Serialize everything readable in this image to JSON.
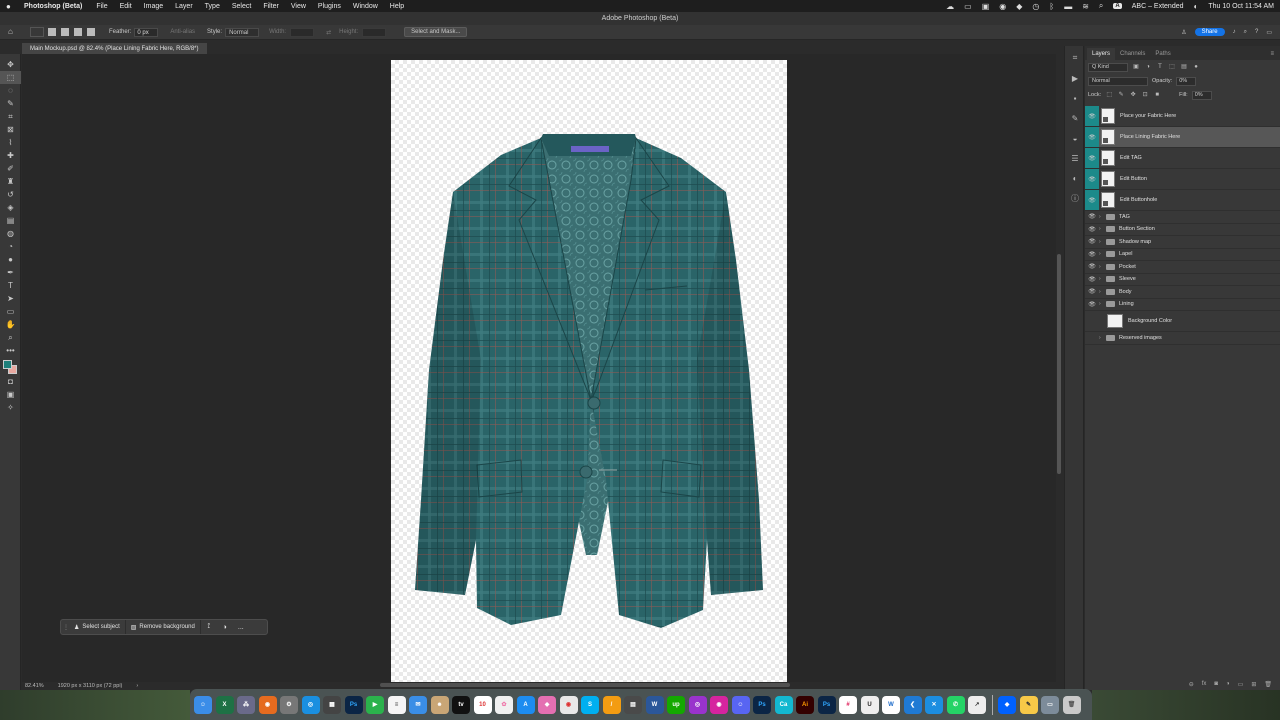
{
  "menubar": {
    "app_name": "Photoshop (Beta)",
    "items": [
      "File",
      "Edit",
      "Image",
      "Layer",
      "Type",
      "Select",
      "Filter",
      "View",
      "Plugins",
      "Window",
      "Help"
    ],
    "input_source": "ABC – Extended",
    "datetime": "Thu 10 Oct  11:54 AM"
  },
  "window": {
    "title": "Adobe Photoshop (Beta)"
  },
  "options": {
    "feather_label": "Feather:",
    "feather_value": "0 px",
    "anti_alias": "Anti-alias",
    "style_label": "Style:",
    "style_value": "Normal",
    "width_label": "Width:",
    "height_label": "Height:",
    "select_mask": "Select and Mask...",
    "share": "Share"
  },
  "document": {
    "tab_title": "Main Mockup.psd @ 82.4% (Place Lining Fabric Here, RGB/8*)",
    "zoom": "82.41%",
    "size_info": "1920 px x 3110 px (72 ppi)"
  },
  "taskbar": {
    "select_subject": "Select subject",
    "remove_background": "Remove background",
    "more": "..."
  },
  "layers_panel": {
    "tabs": [
      "Layers",
      "Channels",
      "Paths"
    ],
    "kind": "Q Kind",
    "blend_mode": "Normal",
    "opacity_label": "Opacity:",
    "opacity_value": "0%",
    "lock_label": "Lock:",
    "fill_label": "Fill:",
    "fill_value": "0%",
    "layers": [
      {
        "name": "Place your Fabric Here",
        "type": "smart",
        "selected": false
      },
      {
        "name": "Place Lining Fabric Here",
        "type": "smart",
        "selected": true
      },
      {
        "name": "Edit TAG",
        "type": "smart",
        "selected": false
      },
      {
        "name": "Edit Button",
        "type": "smart",
        "selected": false
      },
      {
        "name": "Edit Buttonhole",
        "type": "smart",
        "selected": false
      },
      {
        "name": "TAG",
        "type": "group"
      },
      {
        "name": "Button Section",
        "type": "group"
      },
      {
        "name": "Shadow map",
        "type": "group"
      },
      {
        "name": "Lapel",
        "type": "group"
      },
      {
        "name": "Pocket",
        "type": "group"
      },
      {
        "name": "Sleeve",
        "type": "group"
      },
      {
        "name": "Body",
        "type": "group"
      },
      {
        "name": "Lining",
        "type": "group"
      },
      {
        "name": "Background Color",
        "type": "fill"
      },
      {
        "name": "Reserved images",
        "type": "group-hidden"
      }
    ]
  },
  "colors": {
    "foreground": "#1f7f7a",
    "background": "#e8a8a0",
    "jacket": "#2a6468",
    "accent": "#1473e6"
  },
  "dock": {
    "apps": [
      "Finder",
      "Excel",
      "Launchpad",
      "Firefox",
      "Settings",
      "Safari",
      "Calculator",
      "Photoshop",
      "FaceTime",
      "Notes",
      "Mail",
      "Contacts",
      "TV",
      "Calendar",
      "Photos",
      "App Store",
      "Pink app",
      "Chrome",
      "Skype",
      "Sublime",
      "Bridge",
      "Word",
      "Upwork",
      "Podcasts",
      "Instagram",
      "Discord",
      "Photoshop",
      "Canva",
      "Illustrator",
      "Photoshop",
      "Slack",
      "Unity",
      "Wave",
      "Visual Studio Code",
      "Xcode",
      "WhatsApp",
      "Dropbox",
      "Dropbox",
      "Notes",
      "Finder",
      "Trash"
    ]
  }
}
